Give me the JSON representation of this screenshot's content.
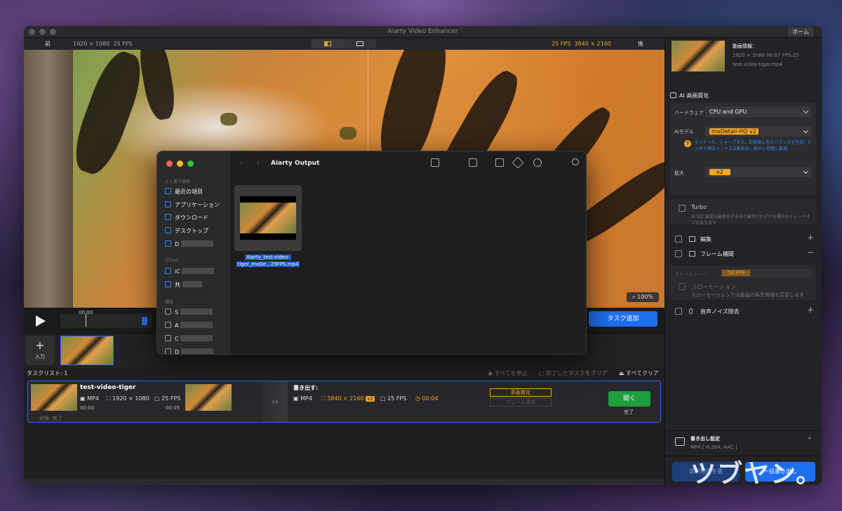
{
  "window": {
    "title": "Aiarty Video Enhancer",
    "home_label": "ホーム"
  },
  "infobar": {
    "before_label": "前",
    "source_resolution": "1920 × 1080",
    "source_fps": "25 FPS",
    "output_fps": "25 FPS",
    "output_resolution": "3840 × 2160",
    "after_label": "後"
  },
  "preview": {
    "zoom": "100%"
  },
  "timeline": {
    "time": "00:00",
    "add_task_label": "タスク追加"
  },
  "thumbstrip": {
    "input_label": "入力"
  },
  "tasklist": {
    "header": "タスクリスト: 1",
    "stop_all": "すべてを停止",
    "clear_done": "完了したタスクをクリア",
    "clear_all": "すべてクリア",
    "task": {
      "name": "test-video-tiger",
      "format": "MP4",
      "resolution": "1920 × 1080",
      "fps": "25 FPS",
      "start": "00:00",
      "end": "00:05",
      "status": "状態: 完了",
      "export_label": "書き出す:",
      "out_format": "MP4",
      "out_resolution": "3840 × 2160",
      "out_scale": "x2",
      "out_fps": "25 FPS",
      "out_duration": "00:04",
      "step_enhance": "高画質化",
      "step_interp": "フレーム補間",
      "open_label": "開く",
      "done_label": "完了"
    }
  },
  "panel": {
    "info_heading": "動画情報：",
    "info_line": "1920 × 1080 00:07 FPS:25",
    "file_name": "test-video-tiger.mp4",
    "ai_title": "AI 高画質化",
    "hardware_label": "ハードウェア",
    "hardware_value": "CPU and GPU",
    "model_label": "AIモデル",
    "model_value": "moDetail-HQ  v2",
    "model_help": "ディテール、シャープネス、彩度度と色のバランスを生成！ピンボケ補正＋ノイズ自動除去、細かい質感に最適。",
    "scale_label": "拡大",
    "scale_value": "x2",
    "turbo_label": "Turbo",
    "turbo_desc": "AI 加工速度を最適化するほど画質がわずかな損失のトレードオフがあります",
    "edit_label": "編集",
    "frame_interp_label": "フレーム補間",
    "frame_rate_label": "フレームレート",
    "frame_rate_value": "50 FPS",
    "slow_motion_label": "スローモーション",
    "slow_motion_desc": "スローモーションでは動画の再生時間を変更します",
    "denoise_label": "音声ノイズ除去",
    "export_settings_title": "書き出し設定",
    "export_settings_value": "MP4 [ H.264, AAC ]",
    "export_selected_label": "選択項目を書",
    "export_all_label": "一括書き出し"
  },
  "finder": {
    "title": "Aiarty Output",
    "favorites_header": "よく使う項目",
    "favorites": [
      "最近の項目",
      "アプリケーション",
      "ダウンロード",
      "デスクトップ",
      "D"
    ],
    "icloud_header": "iCloud",
    "icloud_items": [
      "iC",
      "共"
    ],
    "locations_header": "場所",
    "location_items": [
      "S",
      "A",
      "C",
      "D"
    ],
    "file_name_1": "Aiarty_test-video-",
    "file_name_2": "tiger_moDe...25FPS.mp4"
  },
  "watermark": "ツブヤン。",
  "colors": {
    "accent": "#1e6ff0",
    "orange": "#f5a623",
    "green": "#1e9e3e"
  }
}
